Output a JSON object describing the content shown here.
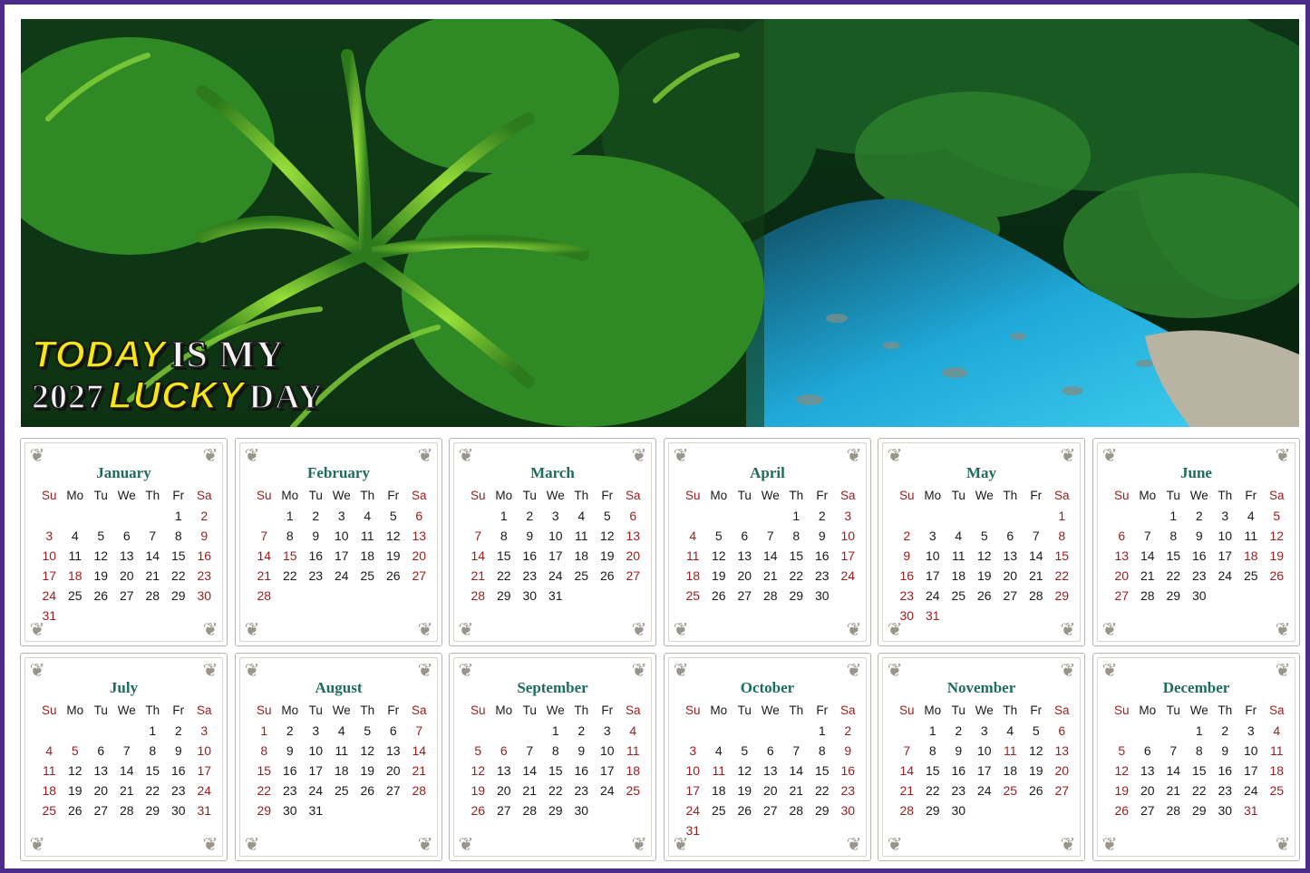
{
  "headline": {
    "line1_highlight": "TODAY",
    "line1_rest": "IS MY",
    "line2_year": "2027",
    "line2_highlight": "LUCKY",
    "line2_rest": "DAY"
  },
  "colors": {
    "frame": "#4a2a8a",
    "month_title": "#1f6b60",
    "weekend_and_holiday": "#9b1c1c",
    "highlight_text": "#f5e51b"
  },
  "weekday_headers": [
    "Su",
    "Mo",
    "Tu",
    "We",
    "Th",
    "Fr",
    "Sa"
  ],
  "months": [
    {
      "name": "January",
      "start": 5,
      "days": 31,
      "holidays": [
        18
      ]
    },
    {
      "name": "February",
      "start": 1,
      "days": 28,
      "holidays": [
        15
      ]
    },
    {
      "name": "March",
      "start": 1,
      "days": 31,
      "holidays": []
    },
    {
      "name": "April",
      "start": 4,
      "days": 30,
      "holidays": []
    },
    {
      "name": "May",
      "start": 6,
      "days": 31,
      "holidays": [
        31
      ]
    },
    {
      "name": "June",
      "start": 2,
      "days": 30,
      "holidays": [
        18
      ]
    },
    {
      "name": "July",
      "start": 4,
      "days": 31,
      "holidays": [
        5
      ]
    },
    {
      "name": "August",
      "start": 0,
      "days": 31,
      "holidays": []
    },
    {
      "name": "September",
      "start": 3,
      "days": 30,
      "holidays": [
        6
      ]
    },
    {
      "name": "October",
      "start": 5,
      "days": 31,
      "holidays": [
        11
      ]
    },
    {
      "name": "November",
      "start": 1,
      "days": 30,
      "holidays": [
        11,
        25
      ]
    },
    {
      "name": "December",
      "start": 3,
      "days": 31,
      "holidays": [
        25,
        31
      ]
    }
  ]
}
